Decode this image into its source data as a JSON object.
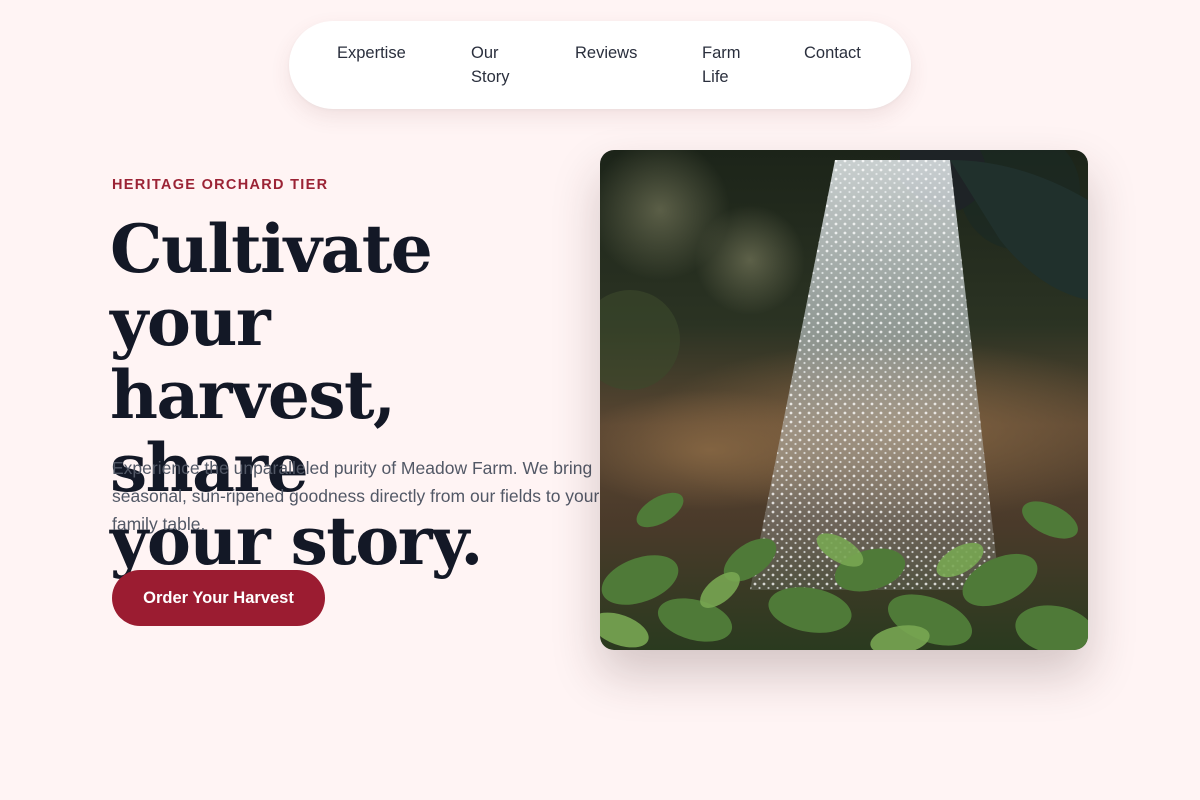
{
  "nav": {
    "items": [
      {
        "label_lines": [
          "Expertise"
        ]
      },
      {
        "label_lines": [
          "Our",
          "Story"
        ]
      },
      {
        "label_lines": [
          "Reviews"
        ]
      },
      {
        "label_lines": [
          "Farm",
          "Life"
        ]
      },
      {
        "label_lines": [
          "Contact"
        ]
      }
    ]
  },
  "hero": {
    "eyebrow": "HERITAGE ORCHARD TIER",
    "headline_lines": [
      "Cultivate your",
      "harvest, share",
      "your story."
    ],
    "description": "Experience the unparalleled purity of Meadow Farm. We bring seasonal, sun-ripened goodness directly from our fields to your family table.",
    "cta_label": "Order Your Harvest"
  },
  "colors": {
    "background": "#fff4f4",
    "accent": "#9b1c31",
    "eyebrow": "#9b2335",
    "heading": "#131826",
    "body_text": "#525866"
  },
  "image": {
    "subject": "watering-can-spraying-water-on-seedlings"
  }
}
